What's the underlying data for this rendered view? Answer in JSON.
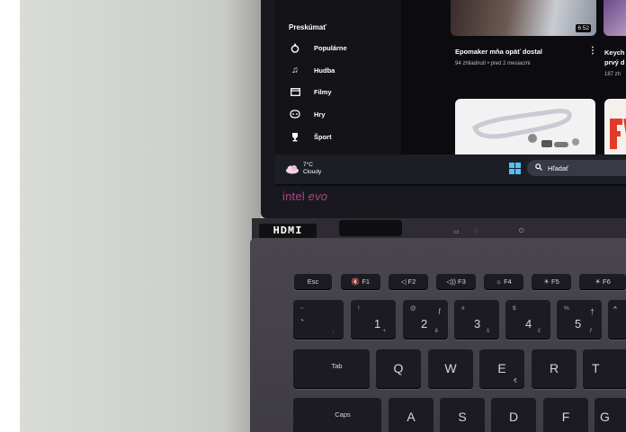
{
  "sidebar": {
    "title": "Preskúmať",
    "items": [
      {
        "label": "Populárne",
        "icon": "fire-icon"
      },
      {
        "label": "Hudba",
        "icon": "music-note-icon"
      },
      {
        "label": "Filmy",
        "icon": "film-icon"
      },
      {
        "label": "Hry",
        "icon": "gamepad-icon"
      },
      {
        "label": "Šport",
        "icon": "trophy-icon"
      }
    ]
  },
  "video": {
    "duration": "6:52",
    "title": "Epomaker mňa opäť dostal",
    "meta": "94 zhliadnutí • pred 2 mesiacmi"
  },
  "side_video": {
    "title_line1": "Keych",
    "title_line2": "prvý d",
    "meta": "187 zh"
  },
  "taskbar": {
    "weather_temp": "7°C",
    "weather_desc": "Cloudy",
    "search_placeholder": "Hľadať"
  },
  "bezel": {
    "brand": "intel",
    "sub": "evo"
  },
  "hinge": {
    "hdmi": "HDMI"
  },
  "keyboard": {
    "fkeys": [
      {
        "label": "Esc"
      },
      {
        "label": "🔇 F1"
      },
      {
        "label": "◁ F2"
      },
      {
        "label": "◁)) F3"
      },
      {
        "label": "☼ F4"
      },
      {
        "label": "☀ F5"
      },
      {
        "label": "☀ F6"
      }
    ],
    "numrow": [
      {
        "main": "`",
        "shift": "~",
        "alt": "",
        "sub": ";"
      },
      {
        "main": "1",
        "shift": "!",
        "alt": "",
        "sub": "+"
      },
      {
        "main": "2",
        "shift": "@",
        "alt": "ľ",
        "sub": "ě"
      },
      {
        "main": "3",
        "shift": "#",
        "alt": "",
        "sub": "š"
      },
      {
        "main": "4",
        "shift": "$",
        "alt": "",
        "sub": "č"
      },
      {
        "main": "5",
        "shift": "%",
        "alt": "†",
        "sub": "ř"
      },
      {
        "main": "^",
        "shift": "",
        "alt": "",
        "sub": ""
      }
    ],
    "tab_label": "Tab",
    "qrow": [
      {
        "main": "Q",
        "sub": ""
      },
      {
        "main": "W",
        "sub": ""
      },
      {
        "main": "E",
        "sub": "€"
      },
      {
        "main": "R",
        "sub": ""
      },
      {
        "main": "T",
        "sub": ""
      }
    ],
    "caps_label": "Caps",
    "arow": [
      {
        "main": "A"
      },
      {
        "main": "S"
      },
      {
        "main": "D"
      },
      {
        "main": "F"
      },
      {
        "main": "G"
      }
    ]
  },
  "colors": {
    "wall": "#d2d4d0",
    "laptop_body": "#423f48",
    "keycap": "#1d1b22",
    "evo_logo": "#a04a84",
    "windows_logo": "#4fc3f7"
  }
}
